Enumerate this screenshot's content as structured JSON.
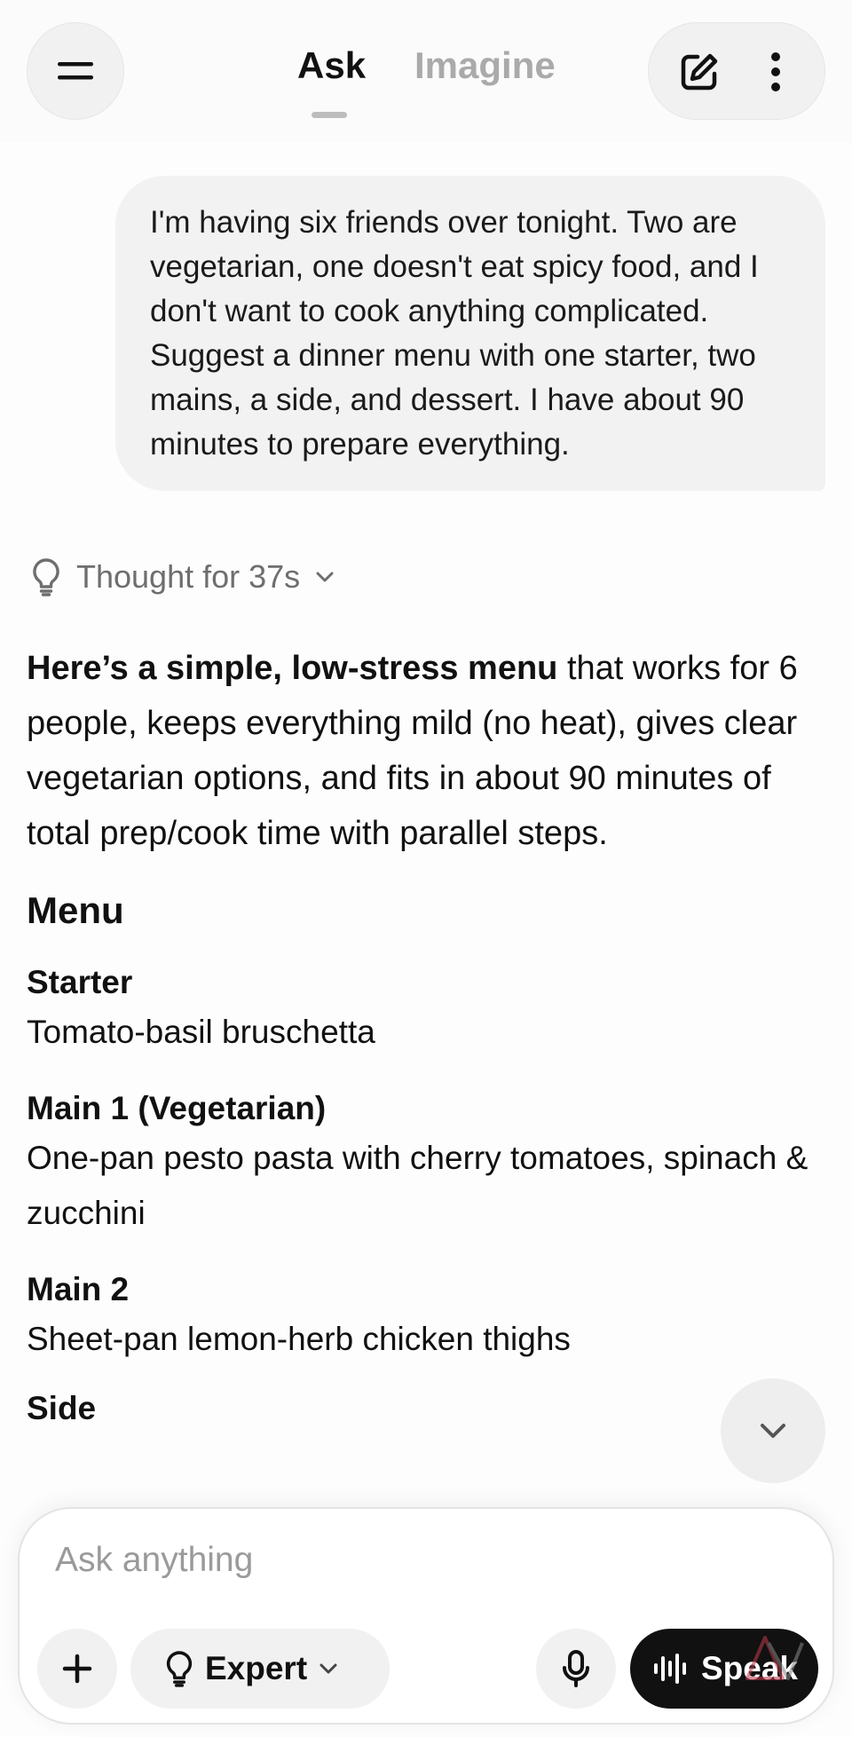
{
  "header": {
    "tabs": [
      {
        "label": "Ask",
        "active": true
      },
      {
        "label": "Imagine",
        "active": false
      }
    ]
  },
  "conversation": {
    "user_message": "I'm having six friends over tonight. Two are vegetarian, one doesn't eat spicy food, and I don't want to cook anything complicated. Suggest a dinner menu with one starter, two mains, a side, and dessert. I have about 90 minutes to prepare everything.",
    "thought_label": "Thought for 37s",
    "response": {
      "intro_bold": "Here’s a simple, low-stress menu",
      "intro_rest": " that works for 6 people, keeps everything mild (no heat), gives clear vegetarian options, and fits in about 90 minutes of total prep/cook time with parallel steps.",
      "menu_heading": "Menu",
      "courses": [
        {
          "title": "Starter",
          "desc": "Tomato-basil bruschetta"
        },
        {
          "title": "Main 1 (Vegetarian)",
          "desc": "One-pan pesto pasta with cherry tomatoes, spinach & zucchini"
        },
        {
          "title": "Main 2",
          "desc": "Sheet-pan lemon-herb chicken thighs"
        }
      ],
      "next_heading_partial": "Side"
    }
  },
  "composer": {
    "placeholder": "Ask anything",
    "model_label": "Expert",
    "speak_label": "Speak"
  },
  "colors": {
    "accent_dark": "#111111",
    "muted_text": "#9a9a9a",
    "pill_bg": "#f1f1f1"
  },
  "icons": [
    "hamburger-menu-icon",
    "edit-icon",
    "more-vertical-icon",
    "lightbulb-icon",
    "chevron-down-icon",
    "plus-icon",
    "microphone-icon",
    "waveform-icon"
  ]
}
